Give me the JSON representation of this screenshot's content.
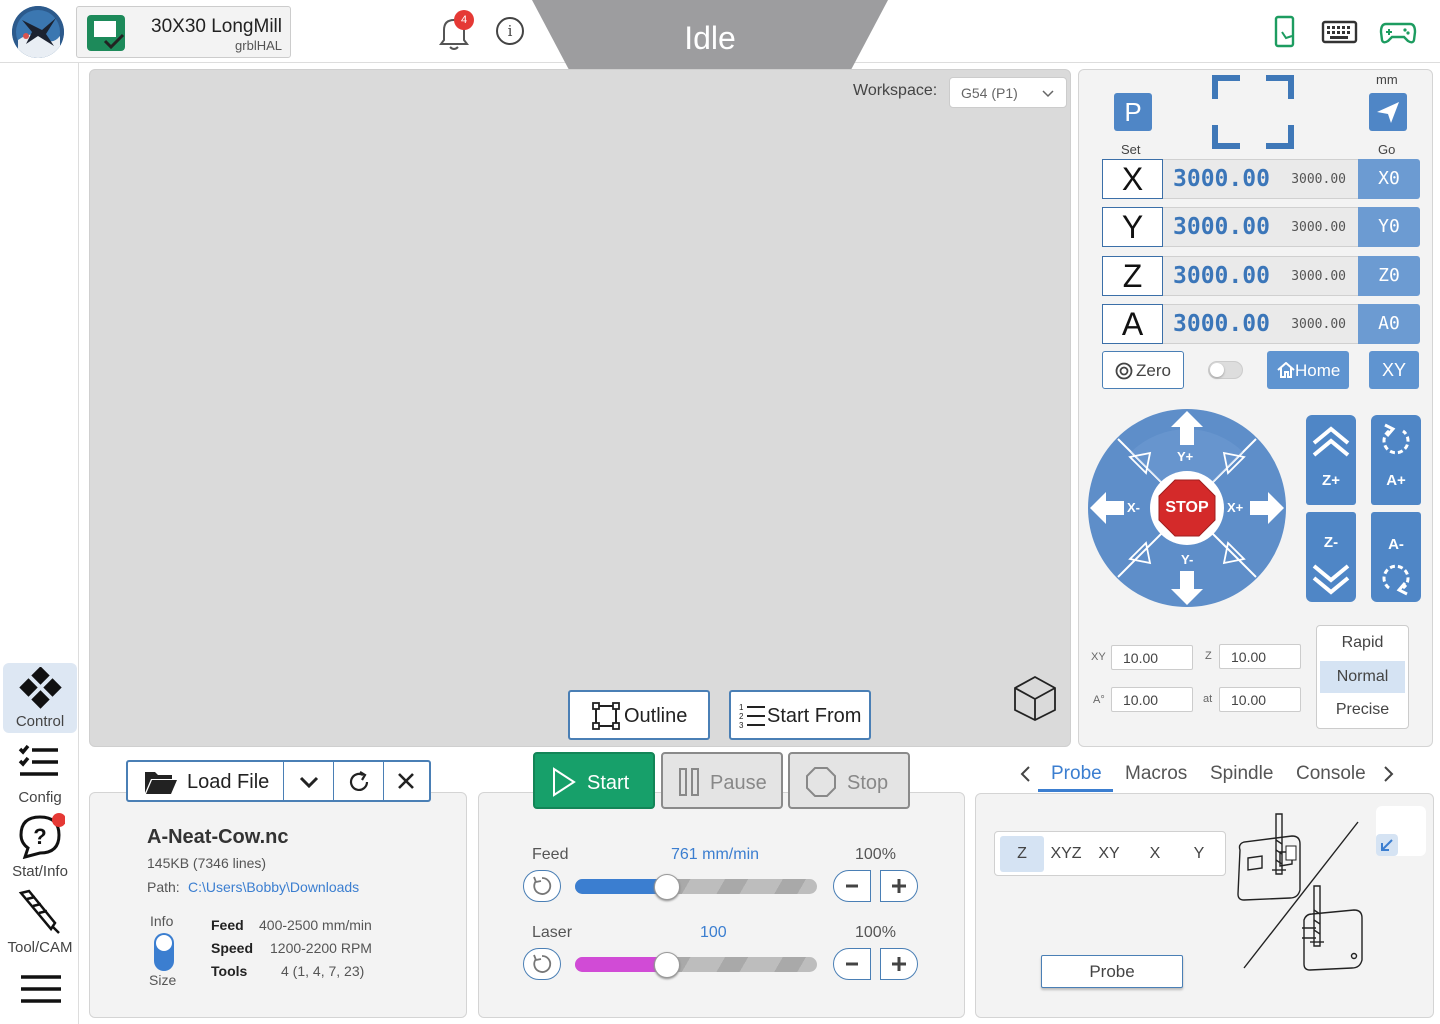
{
  "header": {
    "machine_name": "30X30 LongMill",
    "firmware": "grblHAL",
    "notification_count": "4",
    "status": "Idle",
    "icons": [
      "app-logo-icon",
      "machine-connected-icon",
      "bell-icon",
      "info-icon",
      "phone-remote-icon",
      "keyboard-icon",
      "gamepad-icon"
    ]
  },
  "sidebar": {
    "items": [
      {
        "label": "Control",
        "icon": "control-icon",
        "active": true
      },
      {
        "label": "Config",
        "icon": "config-list-icon"
      },
      {
        "label": "Stat/Info",
        "icon": "help-bubble-icon"
      },
      {
        "label": "Tool/CAM",
        "icon": "endmill-icon"
      }
    ]
  },
  "viewport": {
    "workspace_label": "Workspace:",
    "workspace_value": "G54 (P1)",
    "outline_label": "Outline",
    "start_from_label": "Start From"
  },
  "dro": {
    "units": "mm",
    "set_label": "Set",
    "go_label": "Go",
    "set_button": "P",
    "axes": [
      {
        "name": "X",
        "value": "3000.00",
        "machine": "3000.00",
        "zero": "X0"
      },
      {
        "name": "Y",
        "value": "3000.00",
        "machine": "3000.00",
        "zero": "Y0"
      },
      {
        "name": "Z",
        "value": "3000.00",
        "machine": "3000.00",
        "zero": "Z0"
      },
      {
        "name": "A",
        "value": "3000.00",
        "machine": "3000.00",
        "zero": "A0"
      }
    ],
    "zero_label": "Zero",
    "home_label": "Home",
    "xy_label": "XY"
  },
  "jog": {
    "stop_label": "STOP",
    "yplus": "Y+",
    "yminus": "Y-",
    "xplus": "X+",
    "xminus": "X-",
    "zplus": "Z+",
    "zminus": "Z-",
    "aplus": "A+",
    "aminus": "A-",
    "xy_step_label": "XY",
    "xy_step": "10.00",
    "z_step_label": "Z",
    "z_step": "10.00",
    "a_step_label": "A°",
    "a_step": "10.00",
    "at_label": "at",
    "at_value": "10.00",
    "speeds": [
      "Rapid",
      "Normal",
      "Precise"
    ],
    "selected_speed": "Normal"
  },
  "file": {
    "load_label": "Load File",
    "name": "A-Neat-Cow.nc",
    "size": "145KB (7346 lines)",
    "path_label": "Path:",
    "path": "C:\\Users\\Bobby\\Downloads",
    "toggle_top": "Info",
    "toggle_bottom": "Size",
    "feed_label": "Feed",
    "feed": "400-2500 mm/min",
    "speed_label": "Speed",
    "speed": "1200-2200 RPM",
    "tools_label": "Tools",
    "tools": "4 (1, 4, 7, 23)"
  },
  "controls": {
    "start": "Start",
    "pause": "Pause",
    "stop": "Stop",
    "feed_label": "Feed",
    "feed_value": "761 mm/min",
    "feed_percent": "100%",
    "feed_fill": 0.38,
    "laser_label": "Laser",
    "laser_value": "100",
    "laser_percent": "100%",
    "laser_fill": 0.38,
    "colors": {
      "feed": "#3b7ed0",
      "laser": "#d14bd6",
      "start": "#17a06a"
    }
  },
  "tools_panel": {
    "tabs": [
      "Probe",
      "Macros",
      "Spindle",
      "Console"
    ],
    "active_tab": "Probe",
    "probe_axes": [
      "Z",
      "XYZ",
      "XY",
      "X",
      "Y"
    ],
    "selected_axis": "Z",
    "probe_button": "Probe"
  }
}
